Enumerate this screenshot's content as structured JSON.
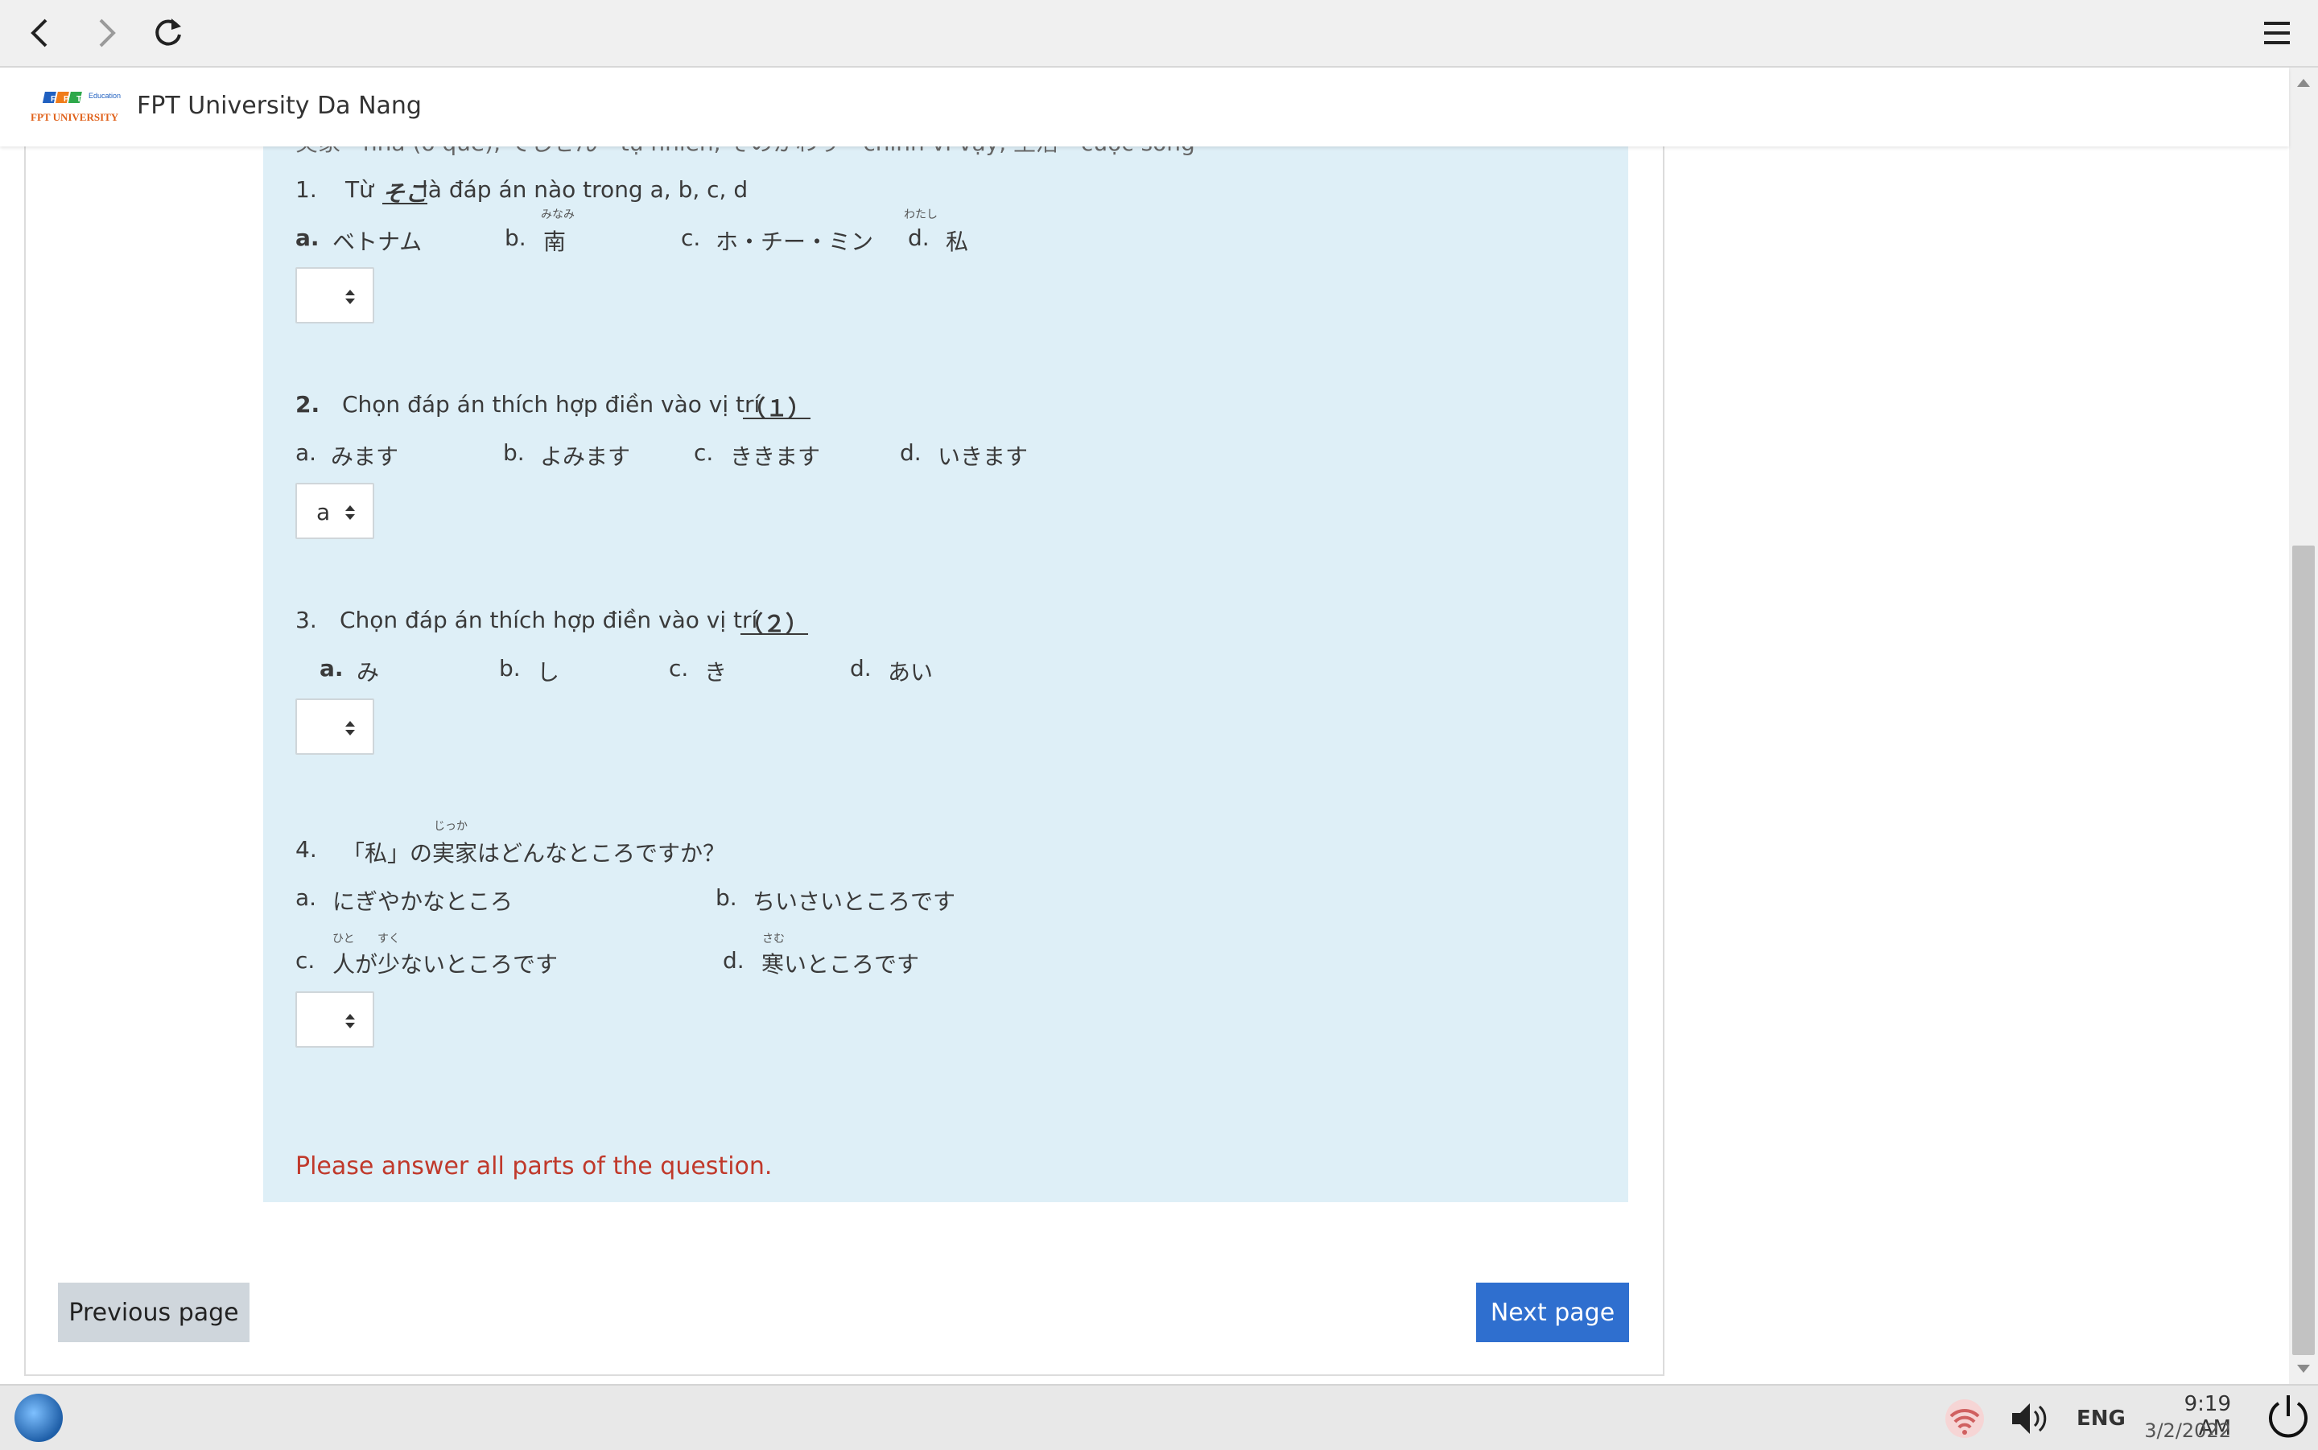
{
  "browser": {
    "back_icon": "back-arrow-icon",
    "forward_icon": "forward-arrow-icon",
    "reload_icon": "reload-icon",
    "menu_icon": "hamburger-menu-icon"
  },
  "header": {
    "site_title": "FPT University Da Nang",
    "logo_text_top": "Education",
    "logo_text_bottom": "FPT UNIVERSITY"
  },
  "passage_cut_line": "実家 - nhà (ở quê), てしぜん - tự nhiên, そのかわり - chính vì vậy, 生活 - cuộc sống",
  "questions": [
    {
      "number": "1.",
      "prefix": "Từ",
      "keyword": "そこ",
      "suffix": "là đáp án nào trong a, b, c, d",
      "options": [
        {
          "letter": "a.",
          "text": "ベトナム"
        },
        {
          "letter": "b.",
          "text": "南",
          "ruby": "みなみ"
        },
        {
          "letter": "c.",
          "text": "ホ・チー・ミン"
        },
        {
          "letter": "d.",
          "text": "私",
          "ruby": "わたし"
        }
      ],
      "selected": ""
    },
    {
      "number": "2.",
      "prompt": "Chọn đáp án thích hợp điền vào vị trí",
      "blank": "（１）",
      "options": [
        {
          "letter": "a.",
          "text": "みます"
        },
        {
          "letter": "b.",
          "text": "よみます"
        },
        {
          "letter": "c.",
          "text": "ききます"
        },
        {
          "letter": "d.",
          "text": "いきます"
        }
      ],
      "selected": "a"
    },
    {
      "number": "3.",
      "prompt": "Chọn đáp án thích hợp điền vào vị trí",
      "blank": "（２）",
      "options": [
        {
          "letter": "a.",
          "text": "み"
        },
        {
          "letter": "b.",
          "text": "し"
        },
        {
          "letter": "c.",
          "text": "き"
        },
        {
          "letter": "d.",
          "text": "あい"
        }
      ],
      "selected": ""
    },
    {
      "number": "4.",
      "prompt": "「私」の実家はどんなところですか？",
      "prompt_ruby": "じっか",
      "options": [
        {
          "letter": "a.",
          "text": "にぎやかなところ"
        },
        {
          "letter": "b.",
          "text": "ちいさいところです"
        },
        {
          "letter": "c.",
          "text": "人が少ないところです",
          "ruby1": "ひと",
          "ruby2": "すく"
        },
        {
          "letter": "d.",
          "text": "寒いところです",
          "ruby": "さむ"
        }
      ],
      "selected": ""
    }
  ],
  "error_message": "Please answer all parts of the question.",
  "nav": {
    "previous_label": "Previous page",
    "next_label": "Next page"
  },
  "taskbar": {
    "start_icon": "start-orb-icon",
    "network_icon": "wifi-disconnected-icon",
    "volume_icon": "volume-icon",
    "language": "ENG",
    "time": "9:19 AM",
    "date": "3/2/2022",
    "power_icon": "power-icon"
  }
}
